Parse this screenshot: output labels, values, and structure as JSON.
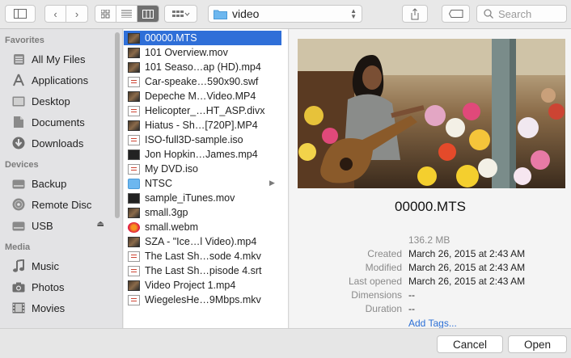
{
  "toolbar": {
    "path_label": "video",
    "search_placeholder": "Search"
  },
  "sidebar": {
    "sections": [
      {
        "title": "Favorites",
        "items": [
          {
            "label": "All My Files",
            "icon": "all-files-icon"
          },
          {
            "label": "Applications",
            "icon": "applications-icon"
          },
          {
            "label": "Desktop",
            "icon": "desktop-icon"
          },
          {
            "label": "Documents",
            "icon": "documents-icon"
          },
          {
            "label": "Downloads",
            "icon": "downloads-icon"
          }
        ]
      },
      {
        "title": "Devices",
        "items": [
          {
            "label": "Backup",
            "icon": "drive-icon"
          },
          {
            "label": "Remote Disc",
            "icon": "disc-icon"
          },
          {
            "label": "USB",
            "icon": "drive-icon"
          }
        ]
      },
      {
        "title": "Media",
        "items": [
          {
            "label": "Music",
            "icon": "music-icon"
          },
          {
            "label": "Photos",
            "icon": "camera-icon"
          },
          {
            "label": "Movies",
            "icon": "film-icon"
          }
        ]
      }
    ]
  },
  "files": [
    {
      "name": "00000.MTS",
      "thumb": "video"
    },
    {
      "name": "101 Overview.mov",
      "thumb": "video"
    },
    {
      "name": "101 Seaso…ap (HD).mp4",
      "thumb": "video"
    },
    {
      "name": "Car-speake…590x90.swf",
      "thumb": "doc"
    },
    {
      "name": "Depeche M…Video.MP4",
      "thumb": "video"
    },
    {
      "name": "Helicopter_…HT_ASP.divx",
      "thumb": "doc"
    },
    {
      "name": "Hiatus - Sh…[720P].MP4",
      "thumb": "video"
    },
    {
      "name": "ISO-full3D-sample.iso",
      "thumb": "doc"
    },
    {
      "name": "Jon Hopkin…James.mp4",
      "thumb": "dark"
    },
    {
      "name": "My DVD.iso",
      "thumb": "doc"
    },
    {
      "name": "NTSC",
      "thumb": "folder"
    },
    {
      "name": "sample_iTunes.mov",
      "thumb": "dark"
    },
    {
      "name": "small.3gp",
      "thumb": "video"
    },
    {
      "name": "small.webm",
      "thumb": "web"
    },
    {
      "name": "SZA - \"Ice…l Video).mp4",
      "thumb": "video"
    },
    {
      "name": "The Last Sh…sode 4.mkv",
      "thumb": "doc"
    },
    {
      "name": "The Last Sh…pisode 4.srt",
      "thumb": "doc"
    },
    {
      "name": "Video Project 1.mp4",
      "thumb": "video"
    },
    {
      "name": "WiegelesHe…9Mbps.mkv",
      "thumb": "doc"
    }
  ],
  "selected_file": "00000.MTS",
  "preview": {
    "name": "00000.MTS",
    "size": "136.2 MB",
    "meta": [
      {
        "key": "Created",
        "value": "March 26, 2015 at 2:43 AM"
      },
      {
        "key": "Modified",
        "value": "March 26, 2015 at 2:43 AM"
      },
      {
        "key": "Last opened",
        "value": "March 26, 2015 at 2:43 AM"
      },
      {
        "key": "Dimensions",
        "value": "--"
      },
      {
        "key": "Duration",
        "value": "--"
      }
    ],
    "add_tags": "Add Tags..."
  },
  "buttons": {
    "cancel": "Cancel",
    "open": "Open"
  },
  "colors": {
    "selection": "#2f6fd8",
    "link": "#2b6fd6"
  }
}
